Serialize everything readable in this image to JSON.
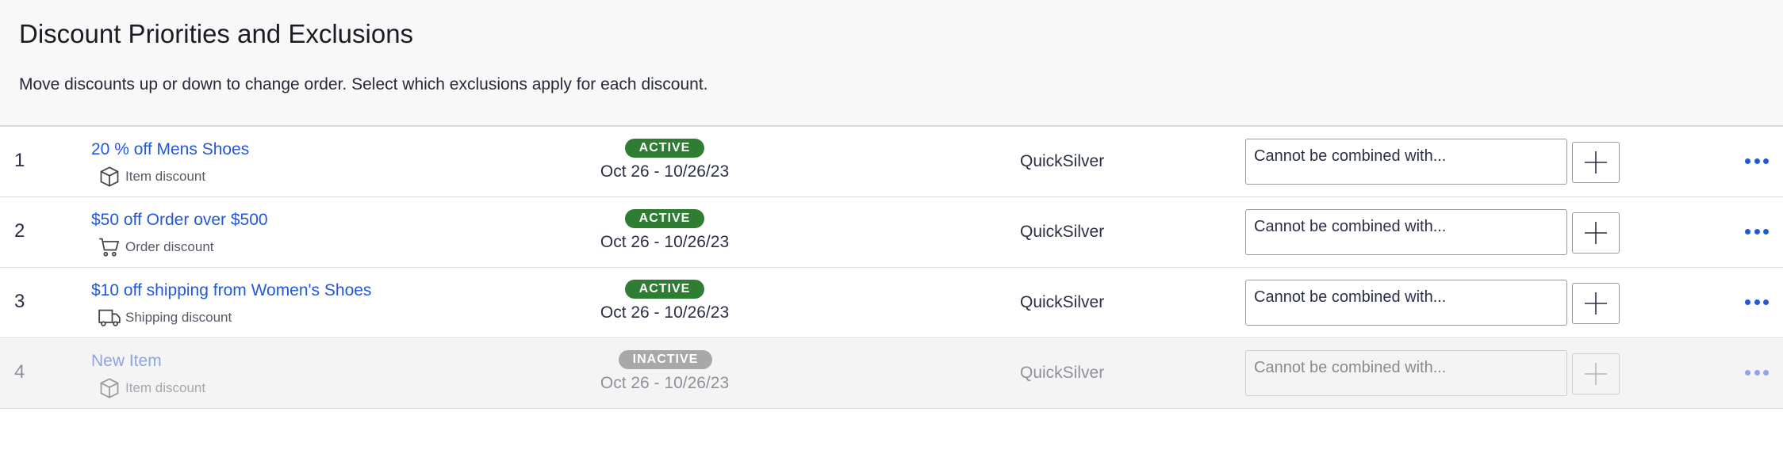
{
  "header": {
    "title": "Discount Priorities and Exclusions",
    "subtitle": "Move discounts up or down to change order. Select which exclusions apply for each discount."
  },
  "rows": [
    {
      "index": "1",
      "name": "20 % off Mens Shoes",
      "type_label": "Item discount",
      "type_icon": "box-icon",
      "status": "ACTIVE",
      "dates": "Oct 26 - 10/26/23",
      "store": "QuickSilver",
      "exclusions_placeholder": "Cannot be combined with...",
      "active": true
    },
    {
      "index": "2",
      "name": "$50 off Order over $500",
      "type_label": "Order discount",
      "type_icon": "cart-icon",
      "status": "ACTIVE",
      "dates": "Oct 26 - 10/26/23",
      "store": "QuickSilver",
      "exclusions_placeholder": "Cannot be combined with...",
      "active": true
    },
    {
      "index": "3",
      "name": "$10 off shipping from Women's Shoes",
      "type_label": "Shipping discount",
      "type_icon": "truck-icon",
      "status": "ACTIVE",
      "dates": "Oct 26 - 10/26/23",
      "store": "QuickSilver",
      "exclusions_placeholder": "Cannot be combined with...",
      "active": true
    },
    {
      "index": "4",
      "name": "New Item",
      "type_label": "Item discount",
      "type_icon": "box-icon",
      "status": "INACTIVE",
      "dates": "Oct 26 - 10/26/23",
      "store": "QuickSilver",
      "exclusions_placeholder": "Cannot be combined with...",
      "active": false
    }
  ],
  "colors": {
    "link": "#2358d8",
    "active_badge": "#2e7d32",
    "inactive_badge": "#a8a8a8",
    "header_bg": "#f8f8f8"
  }
}
